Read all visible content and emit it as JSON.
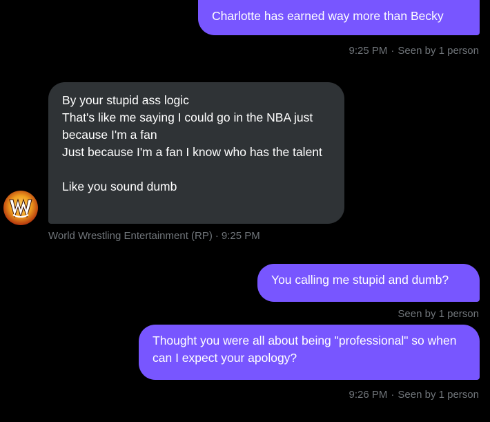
{
  "messages": [
    {
      "id": "m1",
      "direction": "sent",
      "text": "Charlotte has earned way more than Becky",
      "time": "9:25 PM",
      "seen": "Seen by 1 person"
    },
    {
      "id": "m2",
      "direction": "received",
      "text": "By your stupid ass logic\nThat's like me saying I could go in the NBA just because I'm a fan\nJust because I'm a fan I know who has the talent\n\nLike you sound dumb",
      "sender": "World Wrestling Entertainment (RP)",
      "time": "9:25 PM"
    },
    {
      "id": "m3",
      "direction": "sent",
      "text": "You calling me stupid and dumb?",
      "seen": "Seen by 1 person"
    },
    {
      "id": "m4",
      "direction": "sent",
      "text": "Thought you were all about being \"professional\" so when can I expect your apology?",
      "time": "9:26 PM",
      "seen": "Seen by 1 person"
    }
  ],
  "separator": "·",
  "avatar": {
    "icon": "wwe-logo-icon",
    "label": "W"
  },
  "colors": {
    "sent_bubble": "#7856ff",
    "received_bubble": "#2f3336",
    "meta_text": "#71767b",
    "background": "#000000"
  }
}
